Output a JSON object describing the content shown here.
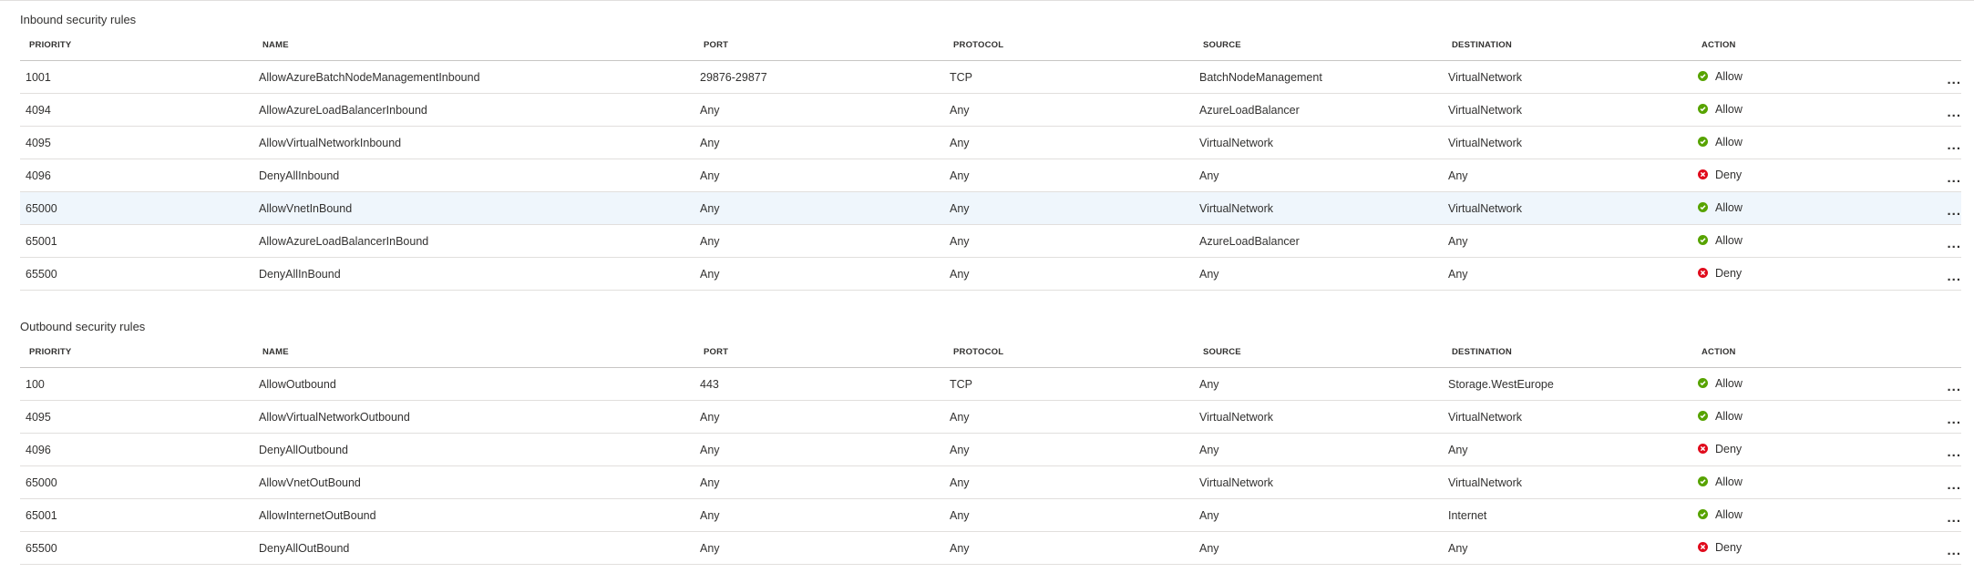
{
  "inbound": {
    "title": "Inbound security rules",
    "columns": [
      "PRIORITY",
      "NAME",
      "PORT",
      "PROTOCOL",
      "SOURCE",
      "DESTINATION",
      "ACTION"
    ],
    "rows": [
      {
        "priority": "1001",
        "name": "AllowAzureBatchNodeManagementInbound",
        "port": "29876-29877",
        "protocol": "TCP",
        "source": "BatchNodeManagement",
        "destination": "VirtualNetwork",
        "action": "Allow",
        "status": "allow"
      },
      {
        "priority": "4094",
        "name": "AllowAzureLoadBalancerInbound",
        "port": "Any",
        "protocol": "Any",
        "source": "AzureLoadBalancer",
        "destination": "VirtualNetwork",
        "action": "Allow",
        "status": "allow"
      },
      {
        "priority": "4095",
        "name": "AllowVirtualNetworkInbound",
        "port": "Any",
        "protocol": "Any",
        "source": "VirtualNetwork",
        "destination": "VirtualNetwork",
        "action": "Allow",
        "status": "allow"
      },
      {
        "priority": "4096",
        "name": "DenyAllInbound",
        "port": "Any",
        "protocol": "Any",
        "source": "Any",
        "destination": "Any",
        "action": "Deny",
        "status": "deny"
      },
      {
        "priority": "65000",
        "name": "AllowVnetInBound",
        "port": "Any",
        "protocol": "Any",
        "source": "VirtualNetwork",
        "destination": "VirtualNetwork",
        "action": "Allow",
        "status": "allow",
        "selected": true
      },
      {
        "priority": "65001",
        "name": "AllowAzureLoadBalancerInBound",
        "port": "Any",
        "protocol": "Any",
        "source": "AzureLoadBalancer",
        "destination": "Any",
        "action": "Allow",
        "status": "allow"
      },
      {
        "priority": "65500",
        "name": "DenyAllInBound",
        "port": "Any",
        "protocol": "Any",
        "source": "Any",
        "destination": "Any",
        "action": "Deny",
        "status": "deny"
      }
    ]
  },
  "outbound": {
    "title": "Outbound security rules",
    "columns": [
      "PRIORITY",
      "NAME",
      "PORT",
      "PROTOCOL",
      "SOURCE",
      "DESTINATION",
      "ACTION"
    ],
    "rows": [
      {
        "priority": "100",
        "name": "AllowOutbound",
        "port": "443",
        "protocol": "TCP",
        "source": "Any",
        "destination": "Storage.WestEurope",
        "action": "Allow",
        "status": "allow"
      },
      {
        "priority": "4095",
        "name": "AllowVirtualNetworkOutbound",
        "port": "Any",
        "protocol": "Any",
        "source": "VirtualNetwork",
        "destination": "VirtualNetwork",
        "action": "Allow",
        "status": "allow"
      },
      {
        "priority": "4096",
        "name": "DenyAllOutbound",
        "port": "Any",
        "protocol": "Any",
        "source": "Any",
        "destination": "Any",
        "action": "Deny",
        "status": "deny"
      },
      {
        "priority": "65000",
        "name": "AllowVnetOutBound",
        "port": "Any",
        "protocol": "Any",
        "source": "VirtualNetwork",
        "destination": "VirtualNetwork",
        "action": "Allow",
        "status": "allow"
      },
      {
        "priority": "65001",
        "name": "AllowInternetOutBound",
        "port": "Any",
        "protocol": "Any",
        "source": "Any",
        "destination": "Internet",
        "action": "Allow",
        "status": "allow"
      },
      {
        "priority": "65500",
        "name": "DenyAllOutBound",
        "port": "Any",
        "protocol": "Any",
        "source": "Any",
        "destination": "Any",
        "action": "Deny",
        "status": "deny"
      }
    ]
  },
  "more_label": "...",
  "colors": {
    "allow": "#57a300",
    "deny": "#e00b1c",
    "selected_row": "#eff6fc"
  },
  "icons": {
    "allow": "check-circle-icon",
    "deny": "x-circle-icon",
    "more": "more-ellipsis-icon"
  }
}
